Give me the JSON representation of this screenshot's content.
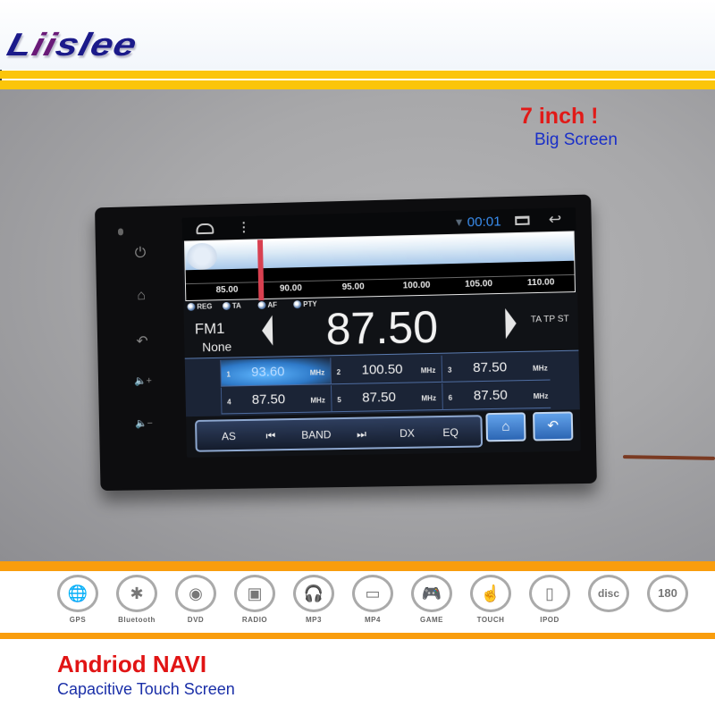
{
  "brand": {
    "logo_text_a": "L",
    "logo_text_ii": "ii",
    "logo_text_b": "slee"
  },
  "promo": {
    "headline": "7 inch !",
    "subline": "Big Screen"
  },
  "device": {
    "bezel_buttons": [
      {
        "icon": "power-icon",
        "glyph": "⏻"
      },
      {
        "icon": "home-icon",
        "glyph": "⌂"
      },
      {
        "icon": "back-icon",
        "glyph": "↶"
      },
      {
        "icon": "volume-up-icon",
        "glyph": "🔈+"
      },
      {
        "icon": "volume-down-icon",
        "glyph": "🔈−"
      }
    ],
    "status_bar": {
      "time": "00:01",
      "wifi_glyph": "▼",
      "menu_glyph": "⋮",
      "back_glyph": "↩"
    },
    "tuner": {
      "scale_labels": [
        "85.00",
        "90.00",
        "95.00",
        "100.00",
        "105.00",
        "110.00"
      ],
      "needle_position_mhz": 87.5
    },
    "options": [
      "REG",
      "TA",
      "AF",
      "PTY"
    ],
    "band": "FM1",
    "station_name": "None",
    "frequency": "87.50",
    "flags": "TA TP ST",
    "presets": [
      {
        "num": "1",
        "value": "93.60",
        "unit": "MHz",
        "active": true
      },
      {
        "num": "2",
        "value": "100.50",
        "unit": "MHz",
        "active": false
      },
      {
        "num": "3",
        "value": "87.50",
        "unit": "MHz",
        "active": false
      },
      {
        "num": "4",
        "value": "87.50",
        "unit": "MHz",
        "active": false
      },
      {
        "num": "5",
        "value": "87.50",
        "unit": "MHz",
        "active": false
      },
      {
        "num": "6",
        "value": "87.50",
        "unit": "MHz",
        "active": false
      }
    ],
    "controls": {
      "as": "AS",
      "prev_glyph": "⏮",
      "band": "BAND",
      "next_glyph": "⏭",
      "dx": "DX",
      "eq": "EQ",
      "home_glyph": "⌂",
      "return_glyph": "↶"
    }
  },
  "features": [
    {
      "label": "GPS",
      "glyph": "🌐"
    },
    {
      "label": "Bluetooth",
      "glyph": "✱"
    },
    {
      "label": "DVD",
      "glyph": "◉"
    },
    {
      "label": "RADIO",
      "glyph": "▣"
    },
    {
      "label": "MP3",
      "glyph": "🎧"
    },
    {
      "label": "MP4",
      "glyph": "▭"
    },
    {
      "label": "GAME",
      "glyph": "🎮"
    },
    {
      "label": "TOUCH",
      "glyph": "☝"
    },
    {
      "label": "IPOD",
      "glyph": "▯"
    },
    {
      "label": "",
      "glyph": "disc"
    },
    {
      "label": "",
      "glyph": "180"
    }
  ],
  "footer": {
    "title": "Andriod NAVI",
    "subtitle": "Capacitive Touch Screen"
  }
}
